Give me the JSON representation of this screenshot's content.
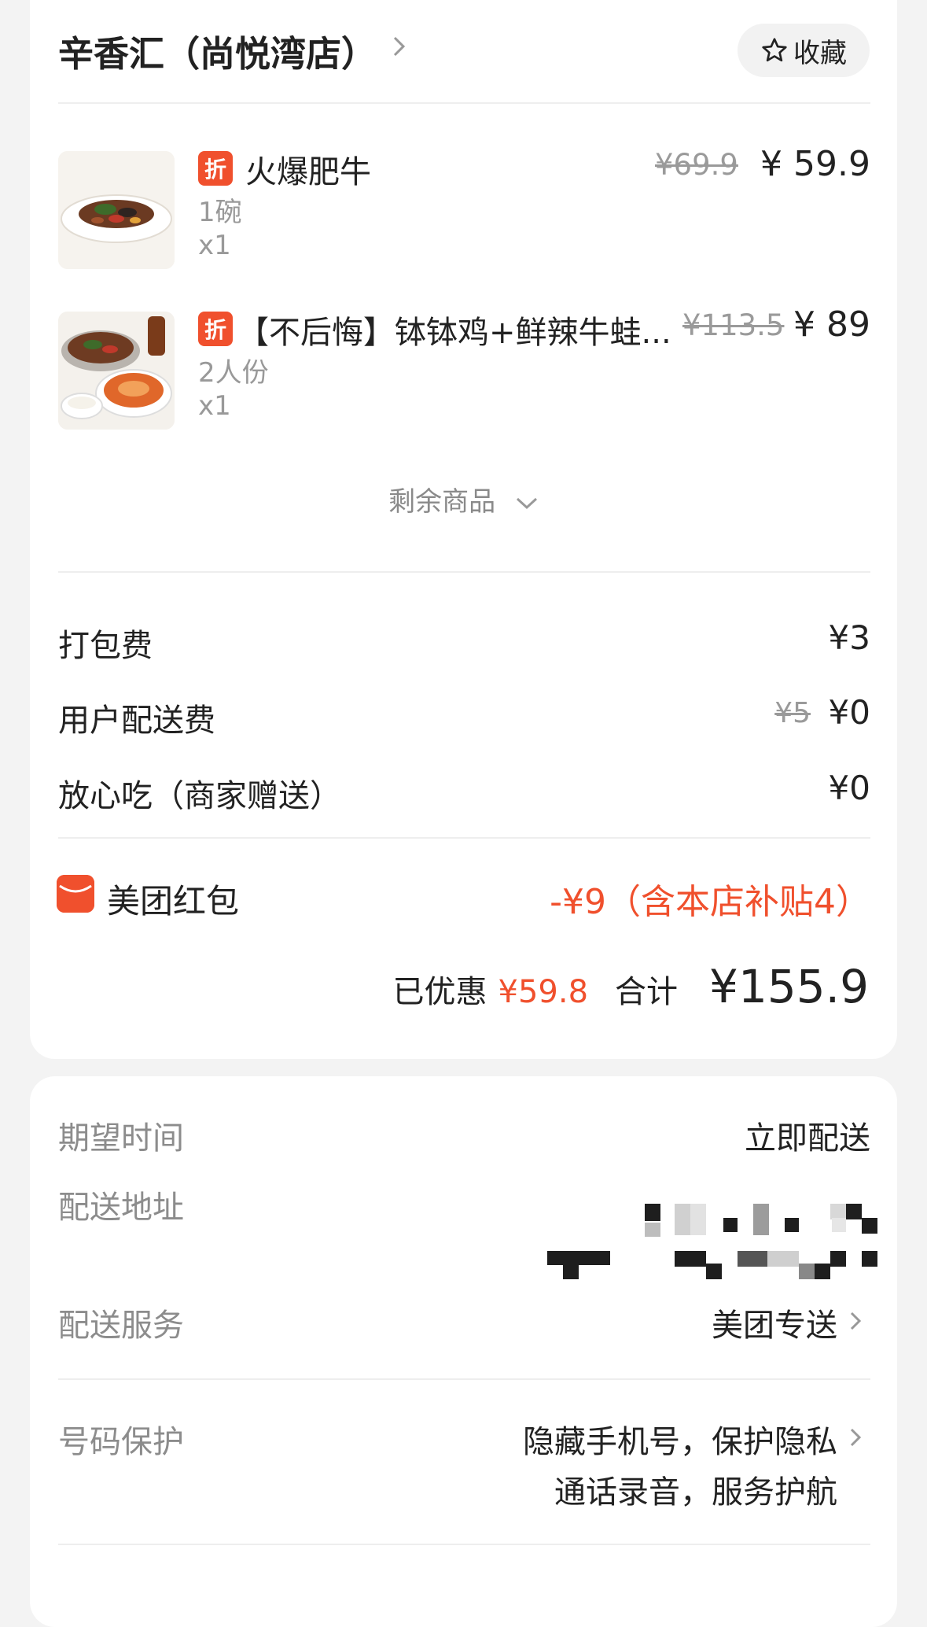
{
  "store": {
    "name": "辛香汇（尚悦湾店）",
    "favorite_label": "收藏"
  },
  "items": [
    {
      "tag": "折",
      "name": "火爆肥牛",
      "spec": "1碗",
      "qty": "x1",
      "old_price": "¥69.9",
      "price": "¥ 59.9",
      "image": "beef-dish-thumbnail"
    },
    {
      "tag": "折",
      "name": "【不后悔】钵钵鸡+鲜辣牛蛙...",
      "spec": "2人份",
      "qty": "x1",
      "old_price": "¥113.5",
      "price": "¥ 89",
      "image": "set-meal-thumbnail"
    }
  ],
  "more_items_label": "剩余商品",
  "fees": [
    {
      "label": "打包费",
      "old": "",
      "value": "¥3"
    },
    {
      "label": "用户配送费",
      "old": "¥5",
      "value": "¥0"
    },
    {
      "label": "放心吃（商家赠送）",
      "old": "",
      "value": "¥0"
    }
  ],
  "red_packet": {
    "label": "美团红包",
    "value": "-¥9（含本店补贴4）"
  },
  "summary": {
    "discount_label": "已优惠",
    "discount_value": "¥59.8",
    "total_label": "合计",
    "total_value": "¥155.9"
  },
  "delivery": {
    "time_label": "期望时间",
    "time_value": "立即配送",
    "address_label": "配送地址",
    "service_label": "配送服务",
    "service_value": "美团专送",
    "privacy_label": "号码保护",
    "privacy_line1": "隐藏手机号，保护隐私",
    "privacy_line2": "通话录音，服务护航"
  },
  "colors": {
    "accent": "#f0502d",
    "muted": "#999999",
    "background": "#f3f3f3"
  }
}
